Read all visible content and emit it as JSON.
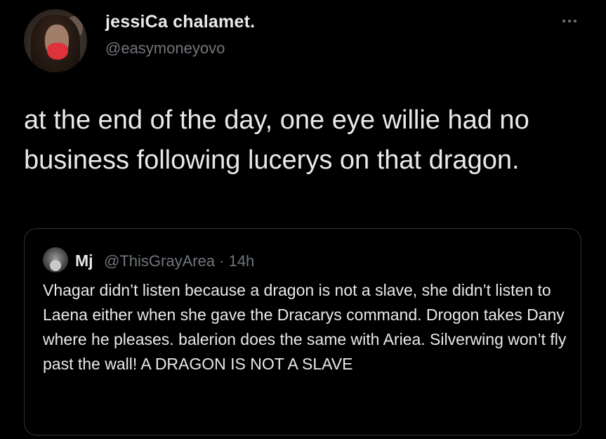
{
  "tweet": {
    "author": {
      "display_name": "jessiCa chalamet.",
      "handle": "@easymoneyovo",
      "avatar": "profile-photo-avatar"
    },
    "more_icon": "more-horizontal-icon",
    "text": "at the end of the day, one eye willie had no business following lucerys on that dragon."
  },
  "quoted_tweet": {
    "author": {
      "display_name": "Mj",
      "handle_time": "@ThisGrayArea · 14h",
      "avatar": "profile-photo-avatar"
    },
    "text": "Vhagar didn’t listen because a dragon is not a slave, she didn’t listen to Laena either when she gave the Dracarys command. Drogon takes Dany where he pleases. balerion does the same with Ariea. Silverwing won’t fly past the wall! A DRAGON IS NOT A SLAVE"
  },
  "colors": {
    "background": "#000000",
    "text_primary": "#e7e9ea",
    "text_secondary": "#71767b",
    "border": "#2f3336"
  }
}
